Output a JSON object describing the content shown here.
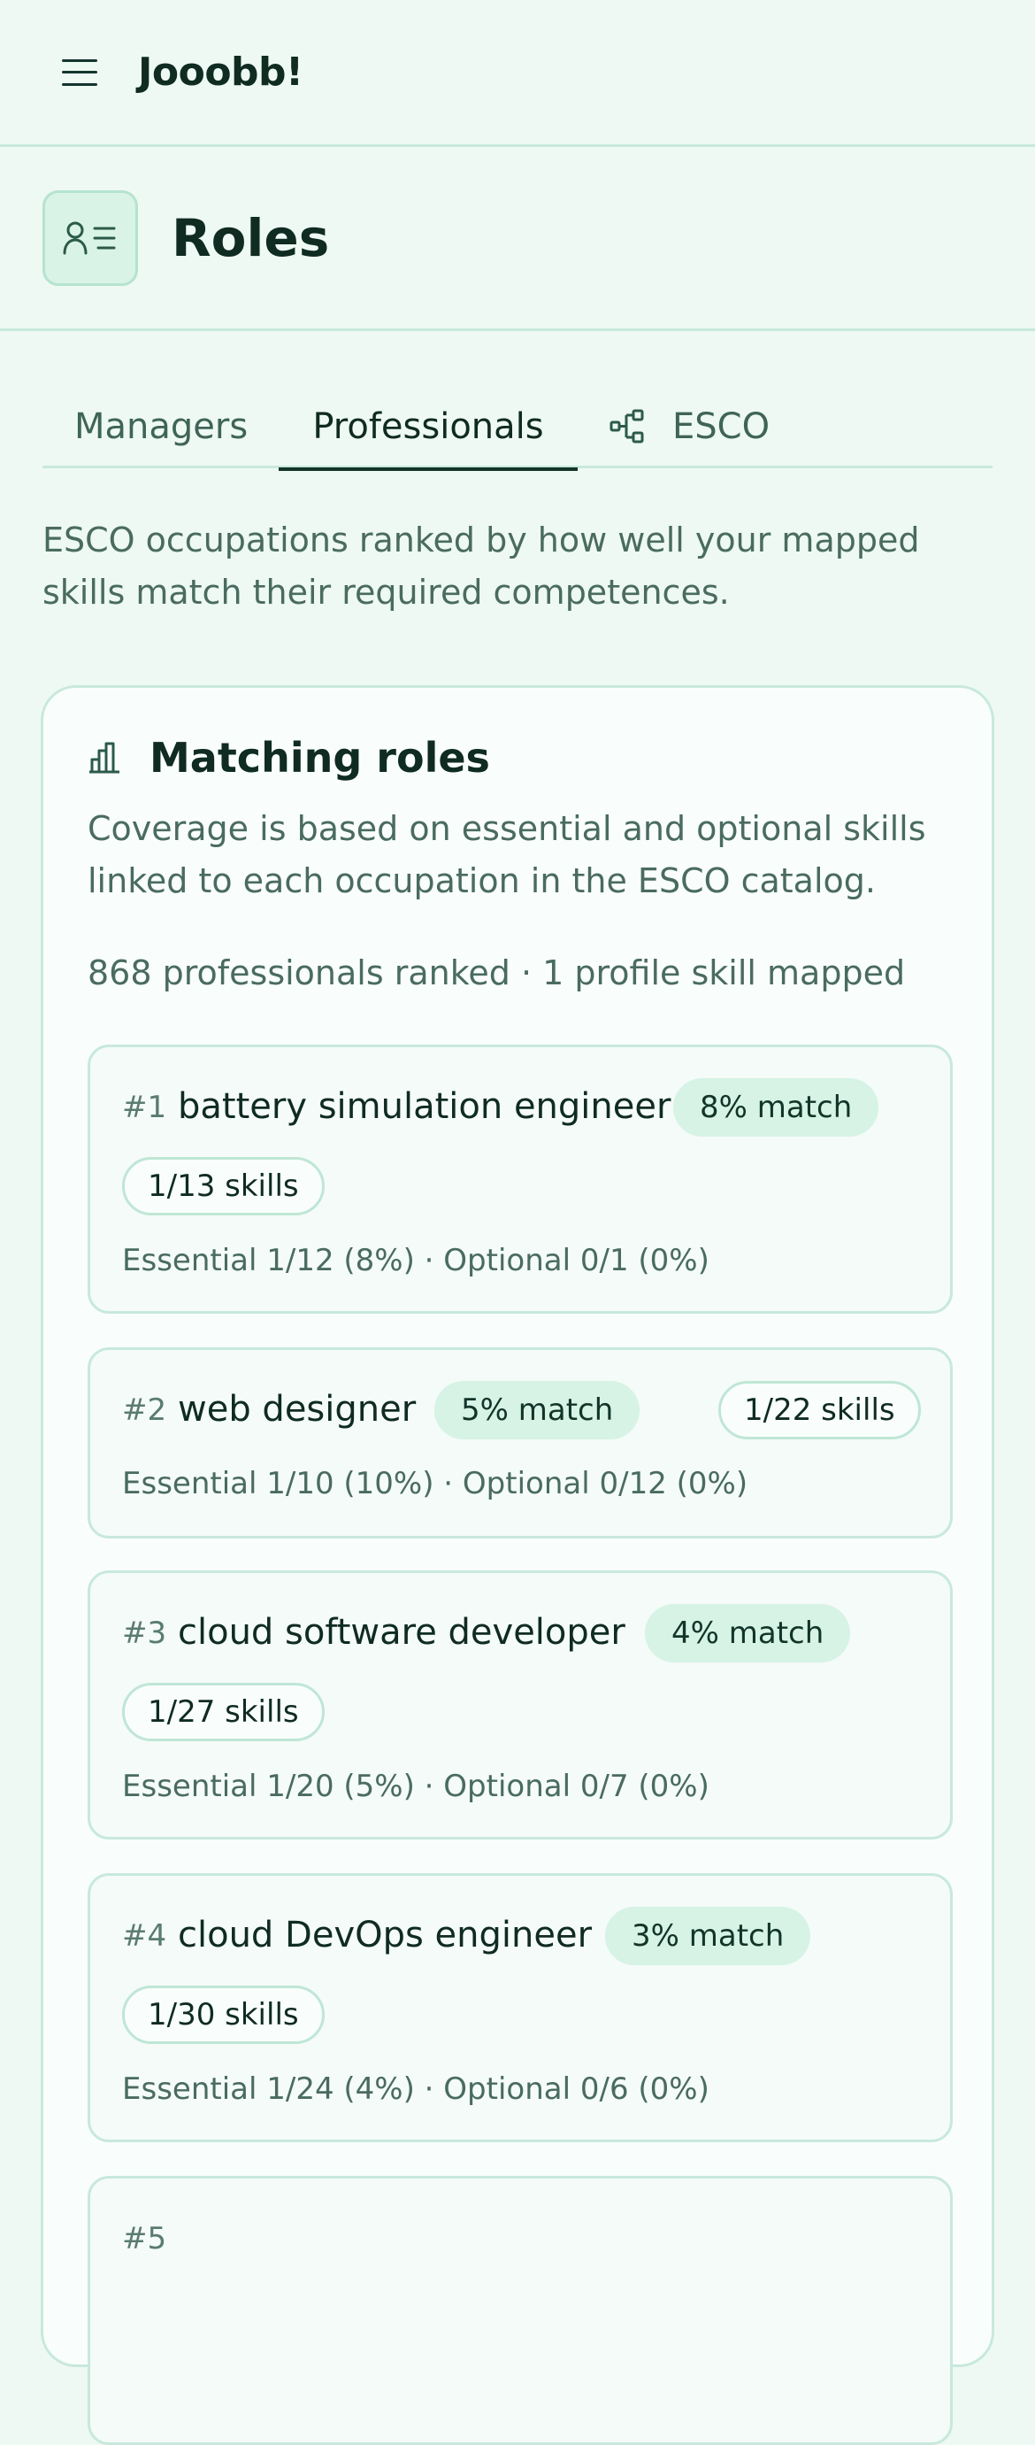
{
  "app": {
    "brand": "Jooobb!"
  },
  "page": {
    "title": "Roles"
  },
  "tabs": [
    {
      "label": "Managers"
    },
    {
      "label": "Professionals"
    },
    {
      "label": "ESCO"
    }
  ],
  "intro": "ESCO occupations ranked by how well your mapped skills match their required competences.",
  "card": {
    "title": "Matching roles",
    "description": "Coverage is based on essential and optional skills linked to each occupation in the ESCO catalog.",
    "summary": "868 professionals ranked · 1 profile skill mapped"
  },
  "roles": [
    {
      "rank": "#1",
      "name": "battery simulation engineer",
      "match": "8% match",
      "skills": "1/13 skills",
      "breakdown": "Essential 1/12 (8%) · Optional 0/1 (0%)"
    },
    {
      "rank": "#2",
      "name": "web designer",
      "match": "5% match",
      "skills": "1/22 skills",
      "breakdown": "Essential 1/10 (10%) · Optional 0/12 (0%)"
    },
    {
      "rank": "#3",
      "name": "cloud software developer",
      "match": "4% match",
      "skills": "1/27 skills",
      "breakdown": "Essential 1/20 (5%) · Optional 0/7 (0%)"
    },
    {
      "rank": "#4",
      "name": "cloud DevOps engineer",
      "match": "3% match",
      "skills": "1/30 skills",
      "breakdown": "Essential 1/24 (4%) · Optional 0/6 (0%)"
    },
    {
      "rank": "#5"
    }
  ],
  "icons": {
    "menu": "menu-icon",
    "roles": "contact-list-icon",
    "esco": "hierarchy-icon",
    "chart": "bar-chart-icon"
  },
  "colors": {
    "background": "#eef9f3",
    "accent": "#d6f3e5",
    "border": "#c8e9dc",
    "text": "#0f2b22",
    "muted": "#4a6b60"
  }
}
